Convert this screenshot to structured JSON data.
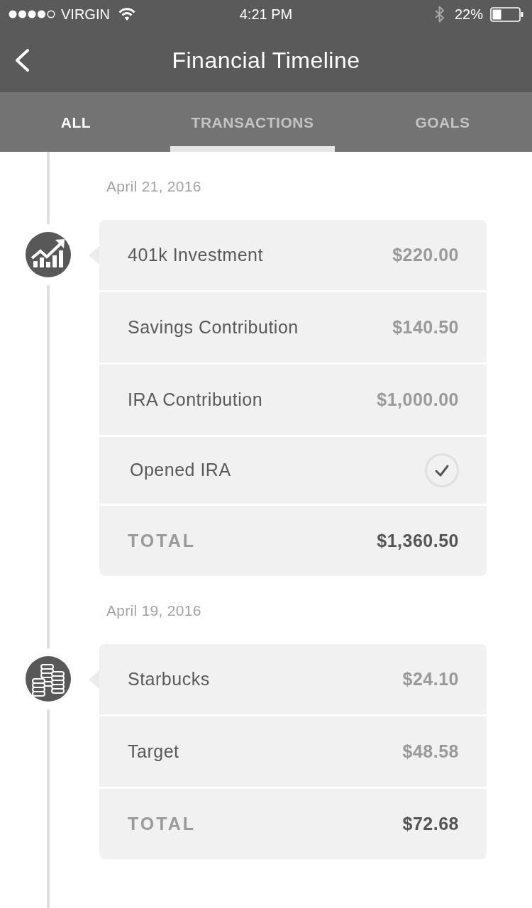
{
  "status_bar": {
    "carrier": "VIRGIN",
    "time": "4:21 PM",
    "battery": "22%"
  },
  "nav_bar": {
    "title": "Financial Timeline"
  },
  "tabs": [
    {
      "label": "ALL",
      "selected": false,
      "highlighted": true
    },
    {
      "label": "TRANSACTIONS",
      "selected": true,
      "highlighted": false
    },
    {
      "label": "GOALS",
      "selected": false,
      "highlighted": false
    }
  ],
  "timeline": [
    {
      "date": "April 21, 2016",
      "kind": "investment",
      "entries": [
        {
          "kind": "amount",
          "label": "401k Investment",
          "amount": "$220.00"
        },
        {
          "kind": "amount",
          "label": "Savings Contribution",
          "amount": "$140.50"
        },
        {
          "kind": "amount",
          "label": "IRA Contribution",
          "amount": "$1,000.00"
        },
        {
          "kind": "check",
          "label": "Opened IRA",
          "checked": true
        }
      ],
      "total": {
        "label": "TOTAL",
        "amount": "$1,360.50"
      }
    },
    {
      "date": "April 19, 2016",
      "kind": "spending",
      "entries": [
        {
          "kind": "amount",
          "label": "Starbucks",
          "amount": "$24.10"
        },
        {
          "kind": "amount",
          "label": "Target",
          "amount": "$48.58"
        }
      ],
      "total": {
        "label": "TOTAL",
        "amount": "$72.68"
      }
    }
  ]
}
